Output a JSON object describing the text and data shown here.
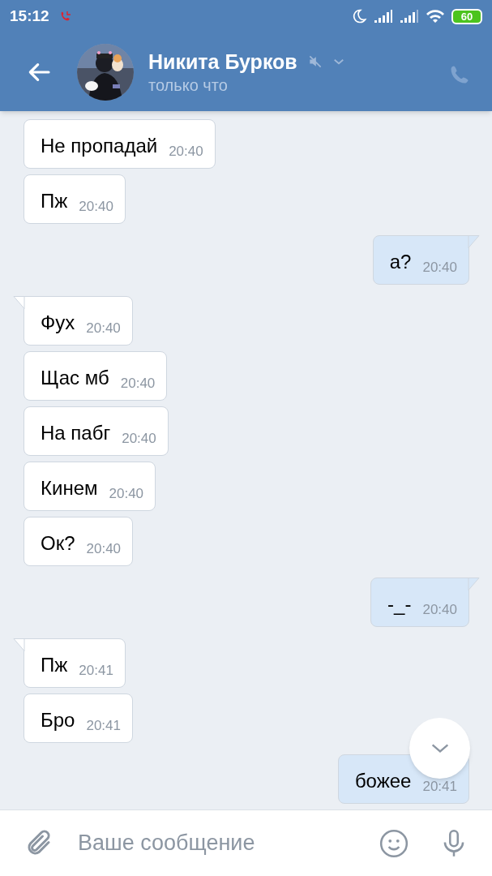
{
  "status_bar": {
    "time": "15:12",
    "battery": "60"
  },
  "header": {
    "name": "Никита Бурков",
    "muted": true,
    "status": "только что"
  },
  "messages": [
    {
      "outgoing": false,
      "tail": false,
      "text": "Не пропадай",
      "time": "20:40"
    },
    {
      "outgoing": false,
      "tail": false,
      "text": "Пж",
      "time": "20:40"
    },
    {
      "outgoing": true,
      "tail": true,
      "text": "а?",
      "time": "20:40"
    },
    {
      "outgoing": false,
      "tail": true,
      "text": "Фух",
      "time": "20:40"
    },
    {
      "outgoing": false,
      "tail": false,
      "text": "Щас мб",
      "time": "20:40"
    },
    {
      "outgoing": false,
      "tail": false,
      "text": "На пабг",
      "time": "20:40"
    },
    {
      "outgoing": false,
      "tail": false,
      "text": "Кинем",
      "time": "20:40"
    },
    {
      "outgoing": false,
      "tail": false,
      "text": "Ок?",
      "time": "20:40"
    },
    {
      "outgoing": true,
      "tail": true,
      "text": "-_-",
      "time": "20:40"
    },
    {
      "outgoing": false,
      "tail": true,
      "text": "Пж",
      "time": "20:41"
    },
    {
      "outgoing": false,
      "tail": false,
      "text": "Бро",
      "time": "20:41"
    },
    {
      "outgoing": true,
      "tail": false,
      "text": "божее",
      "time": "20:41"
    }
  ],
  "composer": {
    "placeholder": "Ваше сообщение"
  }
}
